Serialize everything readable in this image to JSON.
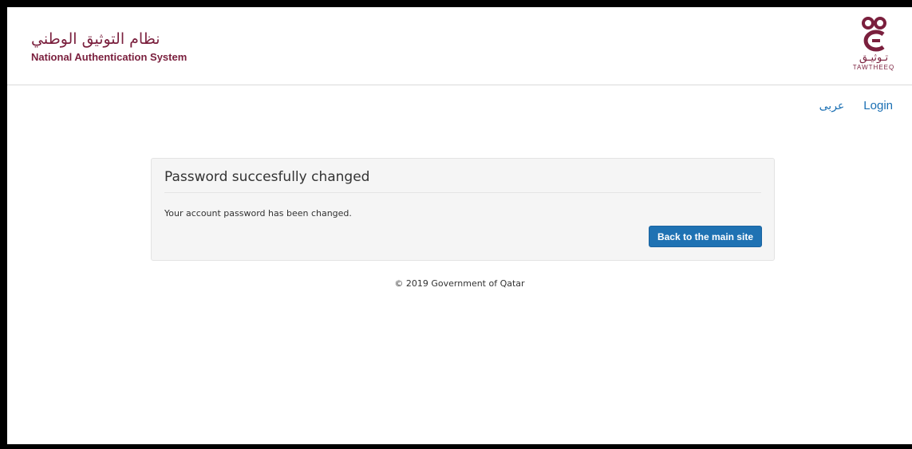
{
  "header": {
    "title_ar": "نظام التوثيق الوطني",
    "title_en": "National Authentication System",
    "logo": {
      "text_ar": "تـوثيـق",
      "text_en": "TAWTHEEQ",
      "icon": "tawtheeq-logo-icon"
    }
  },
  "nav": {
    "login": "Login",
    "language": "عربى"
  },
  "panel": {
    "title": "Password succesfully changed",
    "message": "Your account password has been changed.",
    "button_label": "Back to the main site"
  },
  "footer": {
    "copyright": "© 2019 Government of Qatar"
  },
  "colors": {
    "brand": "#7a1f3d",
    "link": "#1a6fb3",
    "button": "#1f72b3"
  }
}
